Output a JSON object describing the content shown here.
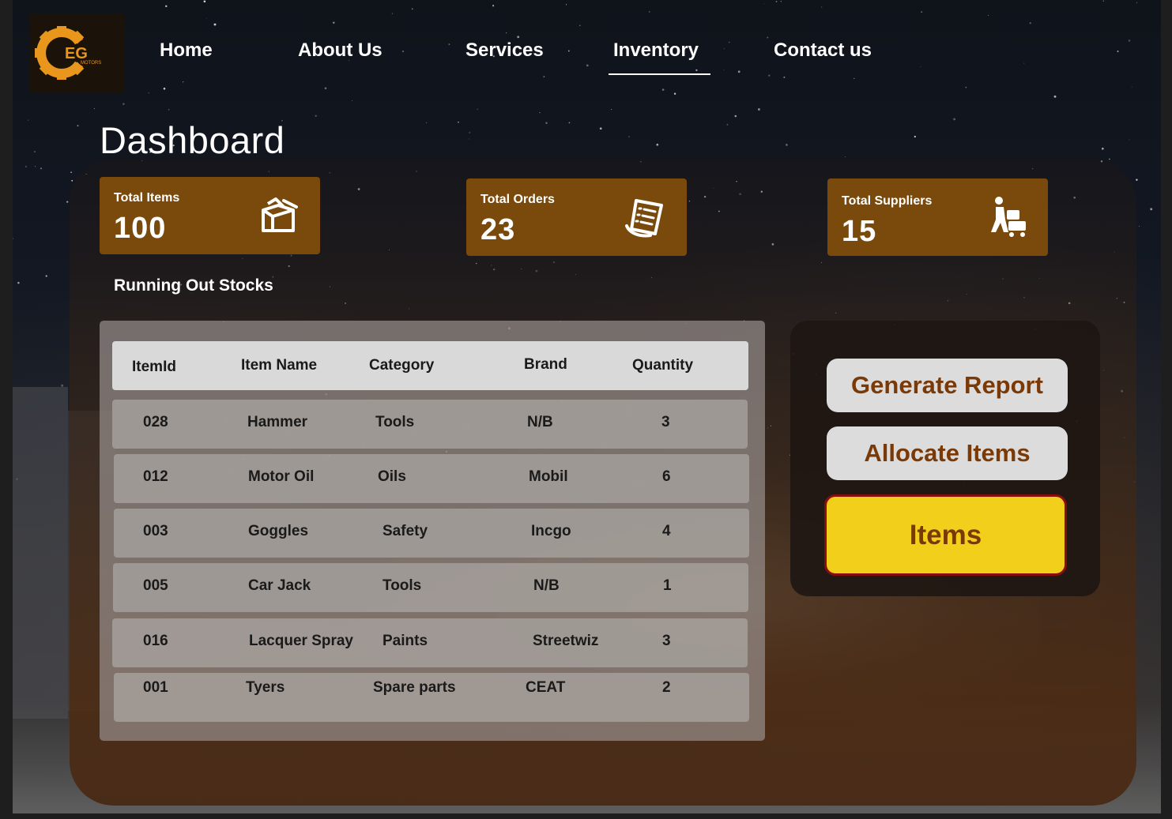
{
  "nav": {
    "logo_text": "EG",
    "logo_sub": "MOTORS",
    "items": [
      {
        "label": "Home"
      },
      {
        "label": "About Us"
      },
      {
        "label": "Services"
      },
      {
        "label": "Inventory"
      },
      {
        "label": "Contact us"
      }
    ],
    "active": "Inventory"
  },
  "page_title": "Dashboard",
  "stats": [
    {
      "label": "Total Items",
      "value": "100",
      "icon": "box-icon"
    },
    {
      "label": "Total Orders",
      "value": "23",
      "icon": "receipt-icon"
    },
    {
      "label": "Total Suppliers",
      "value": "15",
      "icon": "delivery-worker-icon"
    }
  ],
  "section_title": "Running Out Stocks",
  "table": {
    "columns": [
      "ItemId",
      "Item Name",
      "Category",
      "Brand",
      "Quantity"
    ],
    "rows": [
      [
        "028",
        "Hammer",
        "Tools",
        "N/B",
        "3"
      ],
      [
        "012",
        "Motor Oil",
        "Oils",
        "Mobil",
        "6"
      ],
      [
        "003",
        "Goggles",
        "Safety",
        "Incgo",
        "4"
      ],
      [
        "005",
        "Car Jack",
        "Tools",
        "N/B",
        "1"
      ],
      [
        "016",
        "Lacquer Spray",
        "Paints",
        "Streetwiz",
        "3"
      ],
      [
        "001",
        "Tyers",
        "Spare parts",
        "CEAT",
        "2"
      ]
    ]
  },
  "actions": {
    "generate_report": "Generate Report",
    "allocate_items": "Allocate Items",
    "items": "Items"
  },
  "colors": {
    "card_bg": "#7a4a0c",
    "accent_yellow": "#f2cf1a",
    "button_text": "#7a3a08",
    "logo_orange": "#e8961c"
  }
}
